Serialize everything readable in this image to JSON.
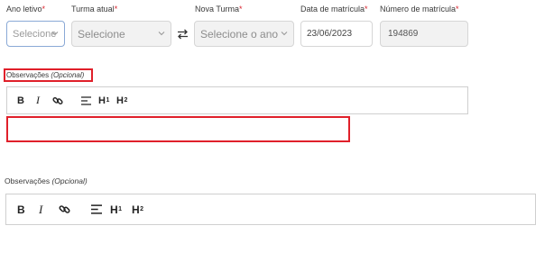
{
  "form": {
    "ano_letivo": {
      "label": "Ano letivo",
      "required_mark": "*",
      "value": "Selecione"
    },
    "turma_atual": {
      "label": "Turma atual",
      "required_mark": "*",
      "value": "Selecione"
    },
    "nova_turma": {
      "label": "Nova Turma",
      "required_mark": "*",
      "value": "Selecione o ano"
    },
    "data_matricula": {
      "label": "Data de matrícula",
      "required_mark": "*",
      "value": "23/06/2023"
    },
    "numero_matricula": {
      "label": "Número de matrícula",
      "required_mark": "*",
      "value": "194869"
    }
  },
  "editor1": {
    "label": "Observações",
    "label_optional": "(Opcional)",
    "tools": {
      "bold": "B",
      "italic": "I",
      "h1": "H",
      "h1_sub": "1",
      "h2": "H",
      "h2_sub": "2"
    }
  },
  "editor2": {
    "label": "Observações",
    "label_optional": "(Opcional)",
    "tools": {
      "bold": "B",
      "italic": "I",
      "h1": "H",
      "h1_sub": "1",
      "h2": "H",
      "h2_sub": "2"
    }
  },
  "colors": {
    "highlight": "#e0202a",
    "focus_border": "#8aa9d6",
    "required": "#d9232d"
  },
  "icons": [
    "chevron-down-icon",
    "swap-arrows-icon",
    "link-icon",
    "align-icon"
  ]
}
